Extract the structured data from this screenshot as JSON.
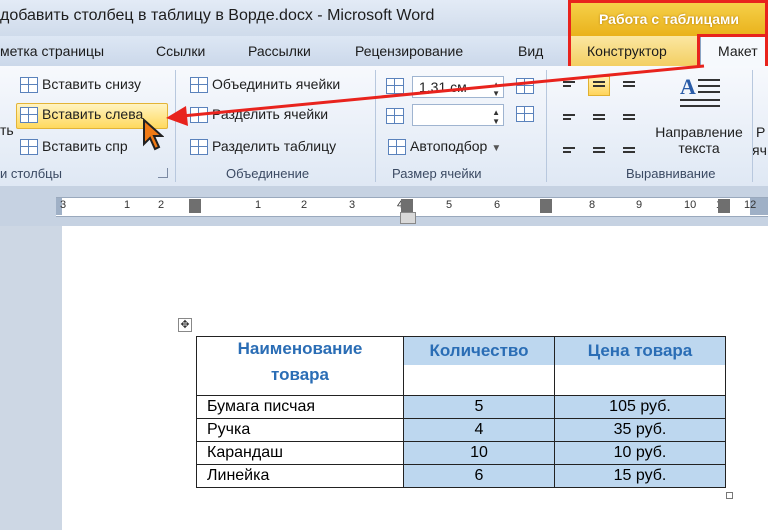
{
  "window": {
    "title": "добавить столбец в таблицу в Ворде.docx - Microsoft Word",
    "context_group": "Работа с таблицами"
  },
  "tabs": {
    "page_layout": "метка страницы",
    "references": "Ссылки",
    "mailings": "Рассылки",
    "review": "Рецензирование",
    "view": "Вид",
    "design": "Конструктор",
    "layout": "Макет"
  },
  "ribbon": {
    "rows_columns": {
      "insert_below": "Вставить снизу",
      "insert_left": "Вставить слева",
      "insert_right": "Вставить спр",
      "left_partial": "ть",
      "label": "и столбцы"
    },
    "merge": {
      "merge_cells": "Объединить ячейки",
      "split_cells": "Разделить ячейки",
      "split_table": "Разделить таблицу",
      "label": "Объединение"
    },
    "cell_size": {
      "height_value": "1,31 см",
      "autofit": "Автоподбор",
      "label": "Размер ячейки"
    },
    "alignment": {
      "text_direction_line1": "Направление",
      "text_direction_line2": "текста",
      "cut_p": "Р",
      "cut_ya": "яч",
      "label": "Выравнивание"
    }
  },
  "ruler": {
    "left_num": "3",
    "numbers": [
      "1",
      "2",
      "1",
      "2",
      "3",
      "4",
      "5",
      "6",
      "7",
      "8",
      "9",
      "10",
      "11",
      "12"
    ]
  },
  "doc_table": {
    "headers": [
      {
        "line1": "Наименование",
        "line2": "товара"
      },
      {
        "line1": "Количество",
        "line2": ""
      },
      {
        "line1": "Цена товара",
        "line2": ""
      }
    ],
    "rows": [
      {
        "name": "Бумага писчая",
        "qty": "5",
        "price": "105 руб."
      },
      {
        "name": "Ручка",
        "qty": "4",
        "price": "35 руб."
      },
      {
        "name": "Карандаш",
        "qty": "10",
        "price": "10 руб."
      },
      {
        "name": "Линейка",
        "qty": "6",
        "price": "15 руб."
      }
    ]
  },
  "colors": {
    "highlight_red": "#e8231d",
    "context_yellow": "#f3cf63",
    "header_blue": "#2a6db5",
    "cell_blue": "#bdd7ef"
  }
}
